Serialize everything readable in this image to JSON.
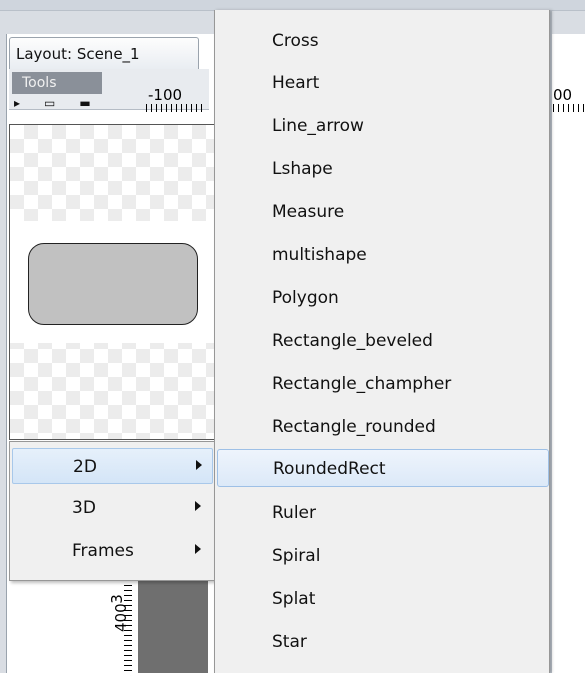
{
  "window": {
    "tab_title": "Layout: Scene_1",
    "tools_label": "Tools",
    "ruler_h_label": "-100",
    "ruler_h_label_right": "00",
    "ruler_v_label": "400",
    "ruler_v_label_top": "3"
  },
  "category_menu": {
    "items": [
      {
        "label": "2D",
        "selected": true
      },
      {
        "label": "3D",
        "selected": false
      },
      {
        "label": "Frames",
        "selected": false
      }
    ]
  },
  "shape_menu": {
    "items": [
      {
        "label": "Cross"
      },
      {
        "label": "Heart"
      },
      {
        "label": "Line_arrow"
      },
      {
        "label": "Lshape"
      },
      {
        "label": "Measure"
      },
      {
        "label": "multishape"
      },
      {
        "label": "Polygon"
      },
      {
        "label": "Rectangle_beveled"
      },
      {
        "label": "Rectangle_champher"
      },
      {
        "label": "Rectangle_rounded"
      },
      {
        "label": "RoundedRect",
        "selected": true
      },
      {
        "label": "Ruler"
      },
      {
        "label": "Spiral"
      },
      {
        "label": "Splat"
      },
      {
        "label": "Star"
      }
    ]
  },
  "colors": {
    "menu_bg": "#f0f0f0",
    "highlight": "#dce9f8",
    "preview_shape_fill": "#c1c1c1"
  }
}
